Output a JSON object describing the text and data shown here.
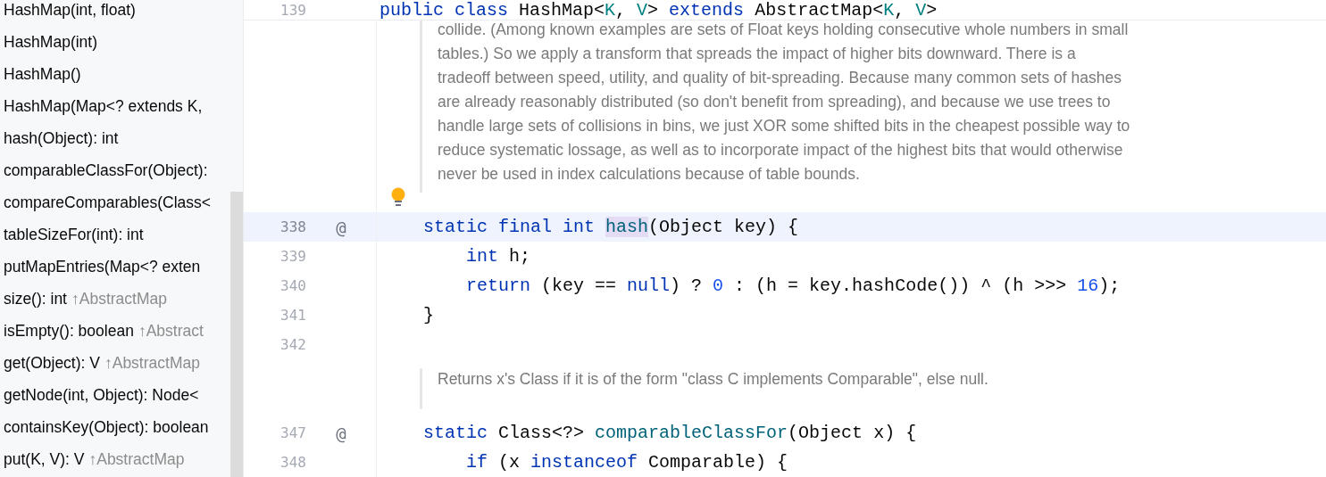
{
  "structure": {
    "items": [
      {
        "label": "HashMap(int, float)"
      },
      {
        "label": "HashMap(int)"
      },
      {
        "label": "HashMap()"
      },
      {
        "label": "HashMap(Map<? extends K,"
      },
      {
        "label": "hash(Object): int"
      },
      {
        "label": "comparableClassFor(Object):"
      },
      {
        "label": "compareComparables(Class<"
      },
      {
        "label": "tableSizeFor(int): int"
      },
      {
        "label": "putMapEntries(Map<? exten"
      },
      {
        "label": "size(): int",
        "inherited": "↑AbstractMap"
      },
      {
        "label": "isEmpty(): boolean",
        "inherited": "↑Abstract"
      },
      {
        "label": "get(Object): V",
        "inherited": "↑AbstractMap"
      },
      {
        "label": "getNode(int, Object): Node<"
      },
      {
        "label": "containsKey(Object): boolean"
      },
      {
        "label": "put(K, V): V",
        "inherited": "↑AbstractMap"
      }
    ]
  },
  "editor": {
    "sticky_line": {
      "number": "139",
      "tokens": [
        {
          "kind": "keyword",
          "text": "public class "
        },
        {
          "kind": "plain",
          "text": "HashMap<"
        },
        {
          "kind": "param",
          "text": "K"
        },
        {
          "kind": "plain",
          "text": ", "
        },
        {
          "kind": "param",
          "text": "V"
        },
        {
          "kind": "plain",
          "text": "> "
        },
        {
          "kind": "keyword",
          "text": "extends "
        },
        {
          "kind": "plain",
          "text": "AbstractMap<"
        },
        {
          "kind": "param",
          "text": "K"
        },
        {
          "kind": "plain",
          "text": ", "
        },
        {
          "kind": "param",
          "text": "V"
        },
        {
          "kind": "plain",
          "text": ">"
        }
      ]
    },
    "blocks": [
      {
        "kind": "doc",
        "intention_bulb": true,
        "lines": [
          "collide. (Among known examples are sets of Float keys holding consecutive whole numbers in small",
          "tables.) So we apply a transform that spreads the impact of higher bits downward. There is a",
          "tradeoff between speed, utility, and quality of bit-spreading. Because many common sets of hashes",
          "are already reasonably distributed (so don't benefit from spreading), and because we use trees to",
          "handle large sets of collisions in bins, we just XOR some shifted bits in the cheapest possible way to",
          "reduce systematic lossage, as well as to incorporate impact of the highest bits that would otherwise",
          "never be used in index calculations because of table bounds."
        ]
      },
      {
        "kind": "code",
        "number": "338",
        "annotation": "@",
        "current": true,
        "tokens": [
          {
            "kind": "keyword",
            "text": "    static final int "
          },
          {
            "kind": "method",
            "text": "hash",
            "highlighted": true
          },
          {
            "kind": "plain",
            "text": "(Object key) {"
          }
        ]
      },
      {
        "kind": "code",
        "number": "339",
        "tokens": [
          {
            "kind": "keyword",
            "text": "        int "
          },
          {
            "kind": "plain",
            "text": "h;"
          }
        ]
      },
      {
        "kind": "code",
        "number": "340",
        "tokens": [
          {
            "kind": "keyword",
            "text": "        return "
          },
          {
            "kind": "plain",
            "text": "(key == "
          },
          {
            "kind": "keyword",
            "text": "null"
          },
          {
            "kind": "plain",
            "text": ") ? "
          },
          {
            "kind": "number",
            "text": "0"
          },
          {
            "kind": "plain",
            "text": " : (h = key.hashCode()) ^ (h >>> "
          },
          {
            "kind": "number",
            "text": "16"
          },
          {
            "kind": "plain",
            "text": ");"
          }
        ]
      },
      {
        "kind": "code",
        "number": "341",
        "tokens": [
          {
            "kind": "plain",
            "text": "    }"
          }
        ]
      },
      {
        "kind": "code",
        "number": "342"
      },
      {
        "kind": "doc",
        "intention_bulb": false,
        "lines": [
          "Returns x's Class if it is of the form \"class C implements Comparable\", else null."
        ]
      },
      {
        "kind": "code",
        "number": "347",
        "annotation": "@",
        "tokens": [
          {
            "kind": "keyword",
            "text": "    static "
          },
          {
            "kind": "plain",
            "text": "Class<?> "
          },
          {
            "kind": "method",
            "text": "comparableClassFor"
          },
          {
            "kind": "plain",
            "text": "(Object x) {"
          }
        ]
      },
      {
        "kind": "code",
        "number": "348",
        "tokens": [
          {
            "kind": "keyword",
            "text": "        if "
          },
          {
            "kind": "plain",
            "text": "(x "
          },
          {
            "kind": "keyword",
            "text": "instanceof "
          },
          {
            "kind": "plain",
            "text": "Comparable) {"
          }
        ]
      }
    ]
  }
}
